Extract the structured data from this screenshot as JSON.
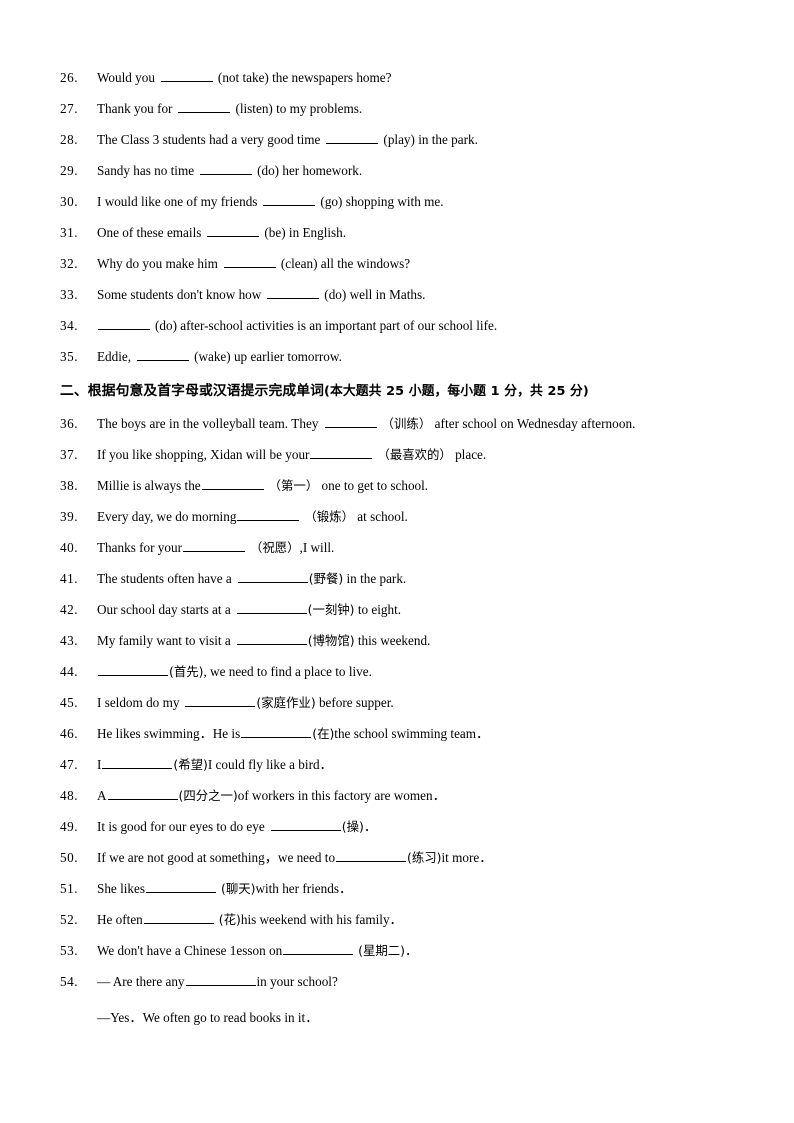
{
  "document": {
    "page_background": "#ffffff",
    "text_color": "#000000"
  },
  "section_one_questions": [
    {
      "number": "26.",
      "pre": "Would you",
      "blank": "md",
      "post": "(not take) the newspapers home?"
    },
    {
      "number": "27.",
      "pre": "Thank you for",
      "blank": "md",
      "post": "(listen) to my problems."
    },
    {
      "number": "28.",
      "pre": "The Class 3 students had a very good time",
      "blank": "md",
      "post": "(play) in the park."
    },
    {
      "number": "29.",
      "pre": "Sandy has no time",
      "blank": "md",
      "post": "(do) her homework."
    },
    {
      "number": "30.",
      "pre": "I would like one of my friends",
      "blank": "md",
      "post": "(go) shopping with me."
    },
    {
      "number": "31.",
      "pre": "One of these emails",
      "blank": "md",
      "post": "(be) in English."
    },
    {
      "number": "32.",
      "pre": "Why do you make him",
      "blank": "md",
      "post": "(clean) all the windows?"
    },
    {
      "number": "33.",
      "pre": "Some students don't know how",
      "blank": "md",
      "post": "(do) well in Maths."
    },
    {
      "number": "34.",
      "pre": "",
      "blank": "md",
      "post": "(do) after-school activities is an important part of our school life."
    },
    {
      "number": "35.",
      "pre": "Eddie,",
      "blank": "md",
      "post": "(wake) up earlier tomorrow."
    }
  ],
  "section_two": {
    "heading_cn": "二、根据句意及首字母或汉语提示完成单词",
    "heading_meta": "(本大题共 25 小题，每小题 1 分，共 25 分)"
  },
  "section_two_questions": [
    {
      "number": "36.",
      "pre": "The boys are in the volleyball team. They",
      "blank": "md",
      "hint": "（训练）",
      "post": "after school on Wednesday afternoon."
    },
    {
      "number": "37.",
      "pre": "If you like shopping, Xidan will be your",
      "blank": "lg",
      "hint": "（最喜欢的）",
      "post": "place."
    },
    {
      "number": "38.",
      "pre": "Millie is always the",
      "blank": "lg",
      "hint": "（第一）",
      "post": "one to get to school."
    },
    {
      "number": "39.",
      "pre": "Every day, we do morning",
      "blank": "lg",
      "hint": "（锻炼）",
      "post": "at school."
    },
    {
      "number": "40.",
      "pre": "Thanks for your",
      "blank": "lg",
      "hint": "（祝愿）",
      "post": ",I will."
    },
    {
      "number": "41.",
      "pre": "The students often have a",
      "blank": "xl",
      "hint": "(野餐)",
      "post": "in the park."
    },
    {
      "number": "42.",
      "pre": "Our school day starts at a",
      "blank": "xl",
      "hint": "(一刻钟)",
      "post": "to eight."
    },
    {
      "number": "43.",
      "pre": "My family want to visit a",
      "blank": "xl",
      "hint": "(博物馆)",
      "post": "this weekend."
    },
    {
      "number": "44.",
      "pre": "",
      "blank": "xl",
      "hint": "(首先)",
      "post": ", we need to find a place to live."
    },
    {
      "number": "45.",
      "pre": "I seldom do my",
      "blank": "xl",
      "hint": "(家庭作业)",
      "post": "before supper."
    },
    {
      "number": "46.",
      "pre": "He likes swimming．He is",
      "blank": "xl",
      "hint": "(在)",
      "post": "the school swimming team．"
    },
    {
      "number": "47.",
      "pre": "I",
      "blank": "xl",
      "hint": "(希望)",
      "post": "I could fly like a bird．"
    },
    {
      "number": "48.",
      "pre": "A",
      "blank": "xl",
      "hint": "(四分之一)",
      "post": "of workers in this factory are women．"
    },
    {
      "number": "49.",
      "pre": "It is good for our eyes to do eye",
      "blank": "xl",
      "hint": "(操)",
      "post": "．"
    },
    {
      "number": "50.",
      "pre": "If we are not good at something，we need to",
      "blank": "xl",
      "hint": "(练习)",
      "post": "it more．"
    },
    {
      "number": "51.",
      "pre": "She likes",
      "blank": "xl",
      "hint": "(聊天)",
      "post": "with her friends．"
    },
    {
      "number": "52.",
      "pre": "He often",
      "blank": "xl",
      "hint": "(花)",
      "post": "his weekend with his family．"
    },
    {
      "number": "53.",
      "pre": "We don't have a Chinese 1esson on",
      "blank": "xl",
      "hint": "(星期二)",
      "post": "．"
    },
    {
      "number": "54.",
      "pre": "— Are there any",
      "blank": "xl",
      "hint": "",
      "post": "in your school?"
    }
  ],
  "followup_line": {
    "text": "—Yes．We often go to read books in it．"
  }
}
